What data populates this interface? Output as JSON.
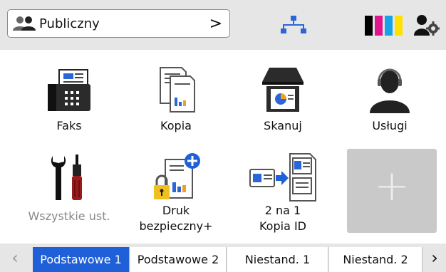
{
  "topbar": {
    "profile_label": "Publiczny",
    "profile_chevron": ">",
    "icons": [
      "users-icon",
      "network-icon",
      "ink-toner-icon",
      "admin-settings-icon"
    ],
    "ink_colors": [
      "#000000",
      "#e0148c",
      "#16a2e6",
      "#ffe100"
    ]
  },
  "tiles": [
    {
      "label": "Faks",
      "icon": "fax-icon"
    },
    {
      "label": "Kopia",
      "icon": "copy-icon"
    },
    {
      "label": "Skanuj",
      "icon": "scan-icon"
    },
    {
      "label": "Usługi",
      "icon": "support-agent-icon"
    },
    {
      "label": "Wszystkie ust.",
      "icon": "tools-icon"
    },
    {
      "label_line1": "Druk",
      "label_line2": "bezpieczny+",
      "icon": "secure-print-icon"
    },
    {
      "label_line1": "2 na 1",
      "label_line2": "Kopia ID",
      "icon": "id-copy-icon"
    }
  ],
  "add_tile": {
    "symbol": "+",
    "icon": "plus-icon"
  },
  "tabs": {
    "left_arrow": "‹",
    "right_arrow": "›",
    "items": [
      "Podstawowe 1",
      "Podstawowe 2",
      "Niestand. 1",
      "Niestand. 2"
    ],
    "active_index": 0
  },
  "colors": {
    "accent": "#1f5fd8",
    "bar_bg": "#e6e6e6"
  }
}
